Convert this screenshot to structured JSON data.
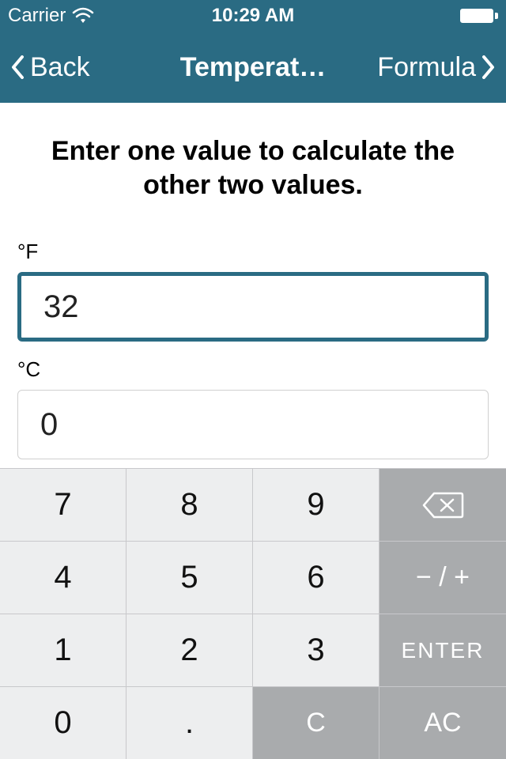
{
  "status": {
    "carrier": "Carrier",
    "time": "10:29 AM"
  },
  "nav": {
    "back_label": "Back",
    "title": "Temperat…",
    "formula_label": "Formula"
  },
  "instruction": "Enter one value to calculate the other two values.",
  "fields": {
    "fahrenheit": {
      "label": "°F",
      "value": "32"
    },
    "celsius": {
      "label": "°C",
      "value": "0"
    }
  },
  "keypad": {
    "k7": "7",
    "k8": "8",
    "k9": "9",
    "k4": "4",
    "k5": "5",
    "k6": "6",
    "k1": "1",
    "k2": "2",
    "k3": "3",
    "k0": "0",
    "kdot": ".",
    "clear": "C",
    "sign": "− / +",
    "enter": "ENTER",
    "all_clear": "AC"
  },
  "colors": {
    "brand": "#2a6b83",
    "key_bg": "#edeeef",
    "fn_bg": "#a9abad"
  }
}
